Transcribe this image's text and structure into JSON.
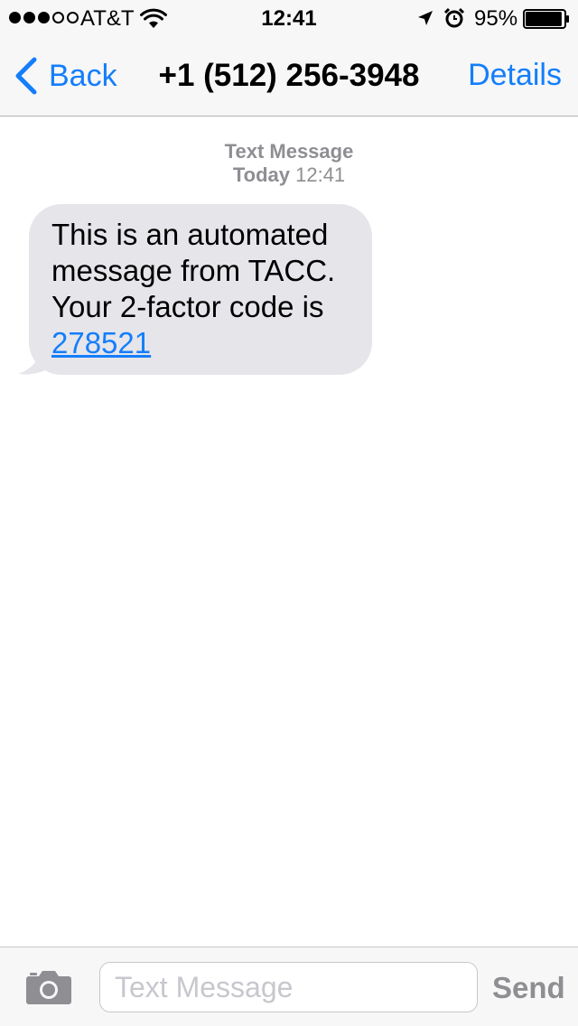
{
  "status_bar": {
    "carrier": "AT&T",
    "time": "12:41",
    "battery_percent": "95%",
    "battery_level": 0.95,
    "signal_bars_filled": 3,
    "signal_bars_total": 5
  },
  "nav": {
    "back_label": "Back",
    "title": "+1 (512) 256-3948",
    "details_label": "Details"
  },
  "conversation": {
    "service_label": "Text Message",
    "day_label": "Today",
    "time": "12:41",
    "messages": [
      {
        "direction": "incoming",
        "text": "This is an automated message from TACC. Your 2-factor code is",
        "link": "278521"
      }
    ]
  },
  "input": {
    "placeholder": "Text Message",
    "send_label": "Send"
  },
  "colors": {
    "accent": "#147efb",
    "bubble_incoming": "#e5e5ea",
    "bar_background": "#f7f7f7",
    "secondary_text": "#8e8e93"
  },
  "icons": [
    "wifi-icon",
    "location-arrow-icon",
    "alarm-clock-icon",
    "battery-icon",
    "chevron-left-icon",
    "camera-icon"
  ]
}
